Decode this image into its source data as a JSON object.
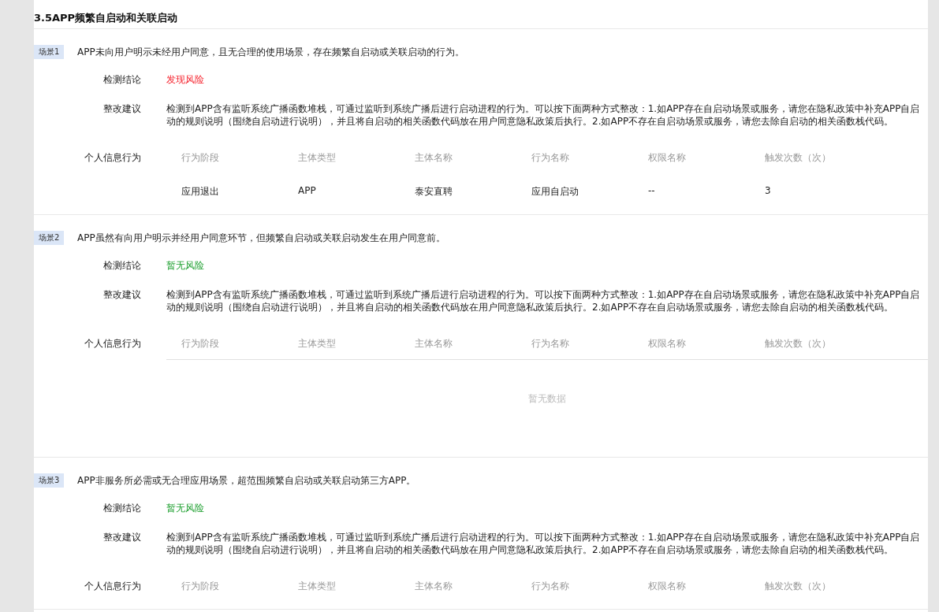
{
  "title": "3.5APP频繁自启动和关联启动",
  "scenarios": [
    {
      "tag": "场景1",
      "description": "APP未向用户明示未经用户同意，且无合理的使用场景，存在频繁自启动或关联启动的行为。",
      "conclusion": {
        "label": "检测结论",
        "value": "发现风险",
        "risk": true
      },
      "suggestion": {
        "label": "整改建议",
        "text": "检测到APP含有监听系统广播函数堆栈，可通过监听到系统广播后进行启动进程的行为。可以按下面两种方式整改：1.如APP存在自启动场景或服务，请您在隐私政策中补充APP自启动的规则说明（围绕自启动进行说明），并且将自启动的相关函数代码放在用户同意隐私政策后执行。2.如APP不存在自启动场景或服务，请您去除自启动的相关函数栈代码。"
      },
      "behavior": {
        "label": "个人信息行为",
        "columns": [
          "行为阶段",
          "主体类型",
          "主体名称",
          "行为名称",
          "权限名称",
          "触发次数（次）"
        ],
        "rows": [
          [
            "应用退出",
            "APP",
            "泰安直聘",
            "应用自启动",
            "--",
            "3"
          ]
        ]
      }
    },
    {
      "tag": "场景2",
      "description": "APP虽然有向用户明示并经用户同意环节，但频繁自启动或关联启动发生在用户同意前。",
      "conclusion": {
        "label": "检测结论",
        "value": "暂无风险",
        "risk": false
      },
      "suggestion": {
        "label": "整改建议",
        "text": "检测到APP含有监听系统广播函数堆栈，可通过监听到系统广播后进行启动进程的行为。可以按下面两种方式整改：1.如APP存在自启动场景或服务，请您在隐私政策中补充APP自启动的规则说明（围绕自启动进行说明），并且将自启动的相关函数代码放在用户同意隐私政策后执行。2.如APP不存在自启动场景或服务，请您去除自启动的相关函数栈代码。"
      },
      "behavior": {
        "label": "个人信息行为",
        "columns": [
          "行为阶段",
          "主体类型",
          "主体名称",
          "行为名称",
          "权限名称",
          "触发次数（次）"
        ],
        "empty": "暂无数据"
      }
    },
    {
      "tag": "场景3",
      "description": "APP非服务所必需或无合理应用场景，超范围频繁自启动或关联启动第三方APP。",
      "conclusion": {
        "label": "检测结论",
        "value": "暂无风险",
        "risk": false
      },
      "suggestion": {
        "label": "整改建议",
        "text": "检测到APP含有监听系统广播函数堆栈，可通过监听到系统广播后进行启动进程的行为。可以按下面两种方式整改：1.如APP存在自启动场景或服务，请您在隐私政策中补充APP自启动的规则说明（围绕自启动进行说明），并且将自启动的相关函数代码放在用户同意隐私政策后执行。2.如APP不存在自启动场景或服务，请您去除自启动的相关函数栈代码。"
      },
      "behavior": {
        "label": "个人信息行为",
        "columns": [
          "行为阶段",
          "主体类型",
          "主体名称",
          "行为名称",
          "权限名称",
          "触发次数（次）"
        ]
      }
    }
  ]
}
